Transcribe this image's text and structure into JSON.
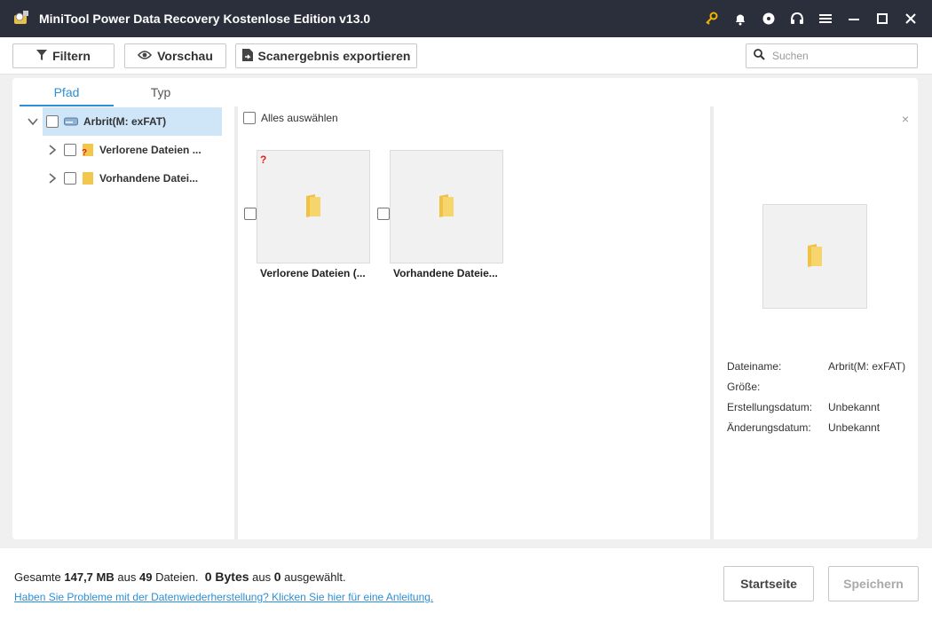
{
  "window": {
    "title": "MiniTool Power Data Recovery Kostenlose Edition v13.0"
  },
  "toolbar": {
    "filter_label": "Filtern",
    "preview_label": "Vorschau",
    "export_label": "Scanergebnis exportieren",
    "search_placeholder": "Suchen"
  },
  "tabs": [
    {
      "label": "Pfad"
    },
    {
      "label": "Typ"
    }
  ],
  "tree": {
    "root": {
      "label": "Arbrit(M: exFAT)"
    },
    "children": [
      {
        "label": "Verlorene Dateien ..."
      },
      {
        "label": "Vorhandene Datei..."
      }
    ]
  },
  "content": {
    "select_all_label": "Alles auswählen",
    "badge": "?",
    "tiles": [
      {
        "label": "Verlorene Dateien (..."
      },
      {
        "label": "Vorhandene Dateie..."
      }
    ]
  },
  "preview": {
    "close": "×",
    "rows": [
      {
        "key": "Dateiname:",
        "value": "Arbrit(M: exFAT)"
      },
      {
        "key": "Größe:",
        "value": ""
      },
      {
        "key": "Erstellungsdatum:",
        "value": "Unbekannt"
      },
      {
        "key": "Änderungsdatum:",
        "value": "Unbekannt"
      }
    ]
  },
  "footer": {
    "summary_prefix": "Gesamte",
    "total_size": "147,7 MB",
    "summary_mid": "aus",
    "file_count": "49",
    "summary_files": "Dateien.",
    "selected_size": "0 Bytes",
    "summary_aus": "aus",
    "selected_count": "0",
    "summary_selected": "ausgewählt.",
    "help_link": "Haben Sie Probleme mit der Datenwiederherstellung? Klicken Sie hier für eine Anleitung.",
    "home_label": "Startseite",
    "save_label": "Speichern"
  },
  "colors": {
    "titlebar": "#2b2e3b",
    "accent": "#2d8fd5",
    "selection": "#cfe6f8",
    "folder": "#f3c74e",
    "key_icon": "#f0b400"
  }
}
